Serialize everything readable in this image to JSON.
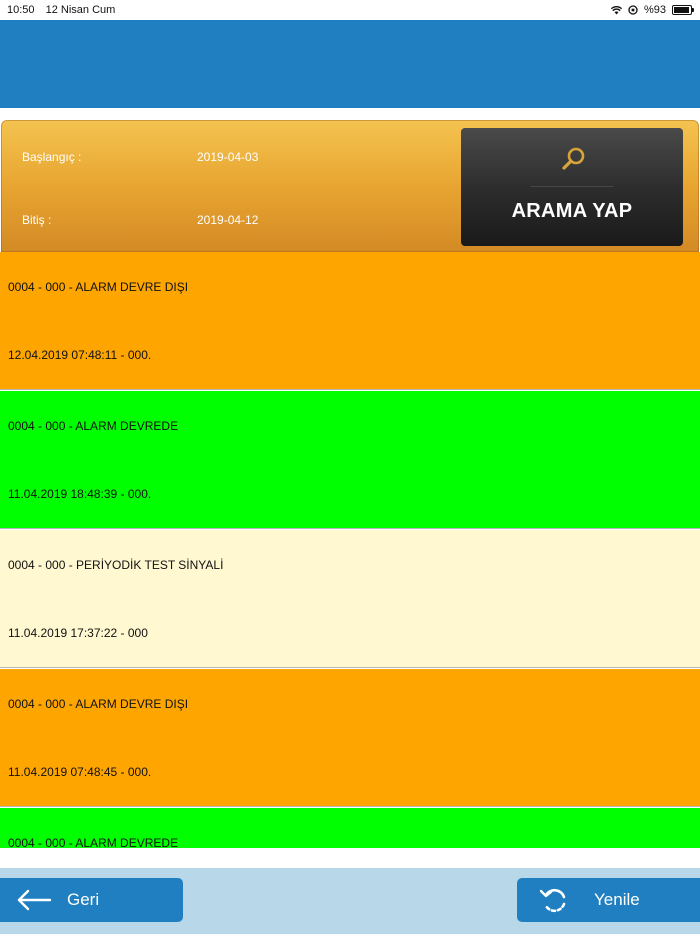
{
  "status_bar": {
    "time": "10:50",
    "date": "12 Nisan Cum",
    "battery": "%93",
    "battery_level": 0.93
  },
  "header": {
    "title": "",
    "color": "#1f7fc0"
  },
  "search": {
    "start_label": "Başlangıç :",
    "start_value": "2019-04-03",
    "end_label": "Bitiş :",
    "end_value": "2019-04-12",
    "button_label": "ARAMA YAP",
    "icon": "search-icon"
  },
  "events": [
    {
      "title": "0004 - 000 - ALARM DEVRE DIŞI",
      "detail": "12.04.2019 07:48:11 - 000.",
      "color": "#ffa500"
    },
    {
      "title": "0004 - 000 - ALARM DEVREDE",
      "detail": "11.04.2019 18:48:39 - 000.",
      "color": "#00ff00"
    },
    {
      "title": "0004 - 000 - PERİYODİK TEST SİNYALİ",
      "detail": "11.04.2019 17:37:22 - 000",
      "color": "#fff8d0"
    },
    {
      "title": "0004 - 000 - ALARM DEVRE DIŞI",
      "detail": "11.04.2019 07:48:45 - 000.",
      "color": "#ffa500"
    },
    {
      "title": "0004 - 000 - ALARM DEVREDE",
      "detail": "",
      "color": "#00ff00"
    }
  ],
  "footer": {
    "back_label": "Geri",
    "back_icon": "arrow-left-icon",
    "refresh_label": "Yenile",
    "refresh_icon": "refresh-icon",
    "bar_color": "#b8d8ea",
    "button_color": "#1f7fc0"
  }
}
